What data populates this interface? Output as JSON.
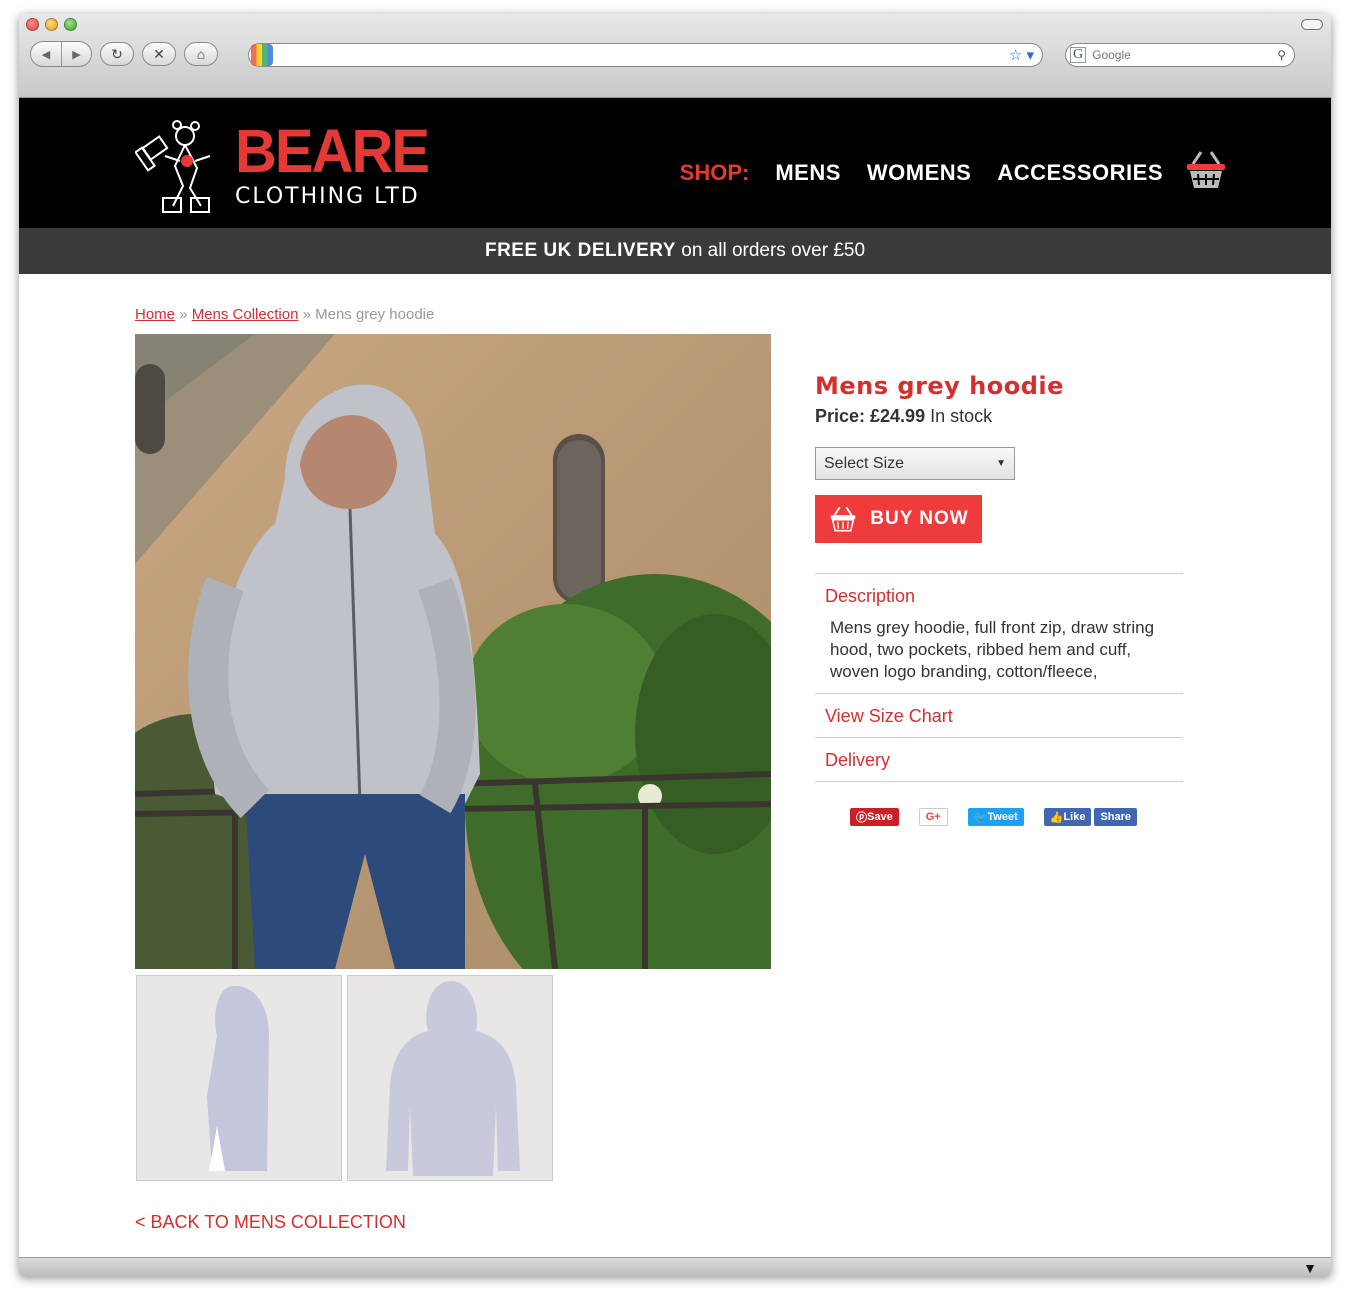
{
  "browser": {
    "url": "",
    "search_placeholder": "Google",
    "search_logo": "G"
  },
  "site": {
    "brand_main": "BEARE",
    "brand_sub": "CLOTHING LTD",
    "nav_shop": "SHOP:",
    "nav": [
      "MENS",
      "WOMENS",
      "ACCESSORIES"
    ],
    "promo_bold": "FREE UK DELIVERY",
    "promo_rest": " on all orders over £50"
  },
  "breadcrumb": {
    "home": "Home",
    "sep1": " » ",
    "collection": "Mens Collection",
    "sep2": " » ",
    "current": "Mens grey hoodie"
  },
  "product": {
    "title": "Mens grey hoodie",
    "price_label": "Price: £24.99",
    "stock": " In stock",
    "size_select": "Select Size",
    "buy_label": "BUY NOW",
    "description_title": "Description",
    "description": "Mens grey hoodie, full front zip, draw string hood, two pockets, ribbed hem and cuff, woven logo branding, cotton/fleece,",
    "size_chart": "View Size Chart",
    "delivery": "Delivery"
  },
  "social": {
    "pin": "Save",
    "gplus": "G+",
    "tweet": "Tweet",
    "like": "Like",
    "share": "Share"
  },
  "back_link": "< BACK TO MENS COLLECTION",
  "colors": {
    "accent": "#e53935",
    "header_bg": "#000000",
    "promo_bg": "#3a3a3a",
    "buy_bg": "#ef3b3b"
  }
}
